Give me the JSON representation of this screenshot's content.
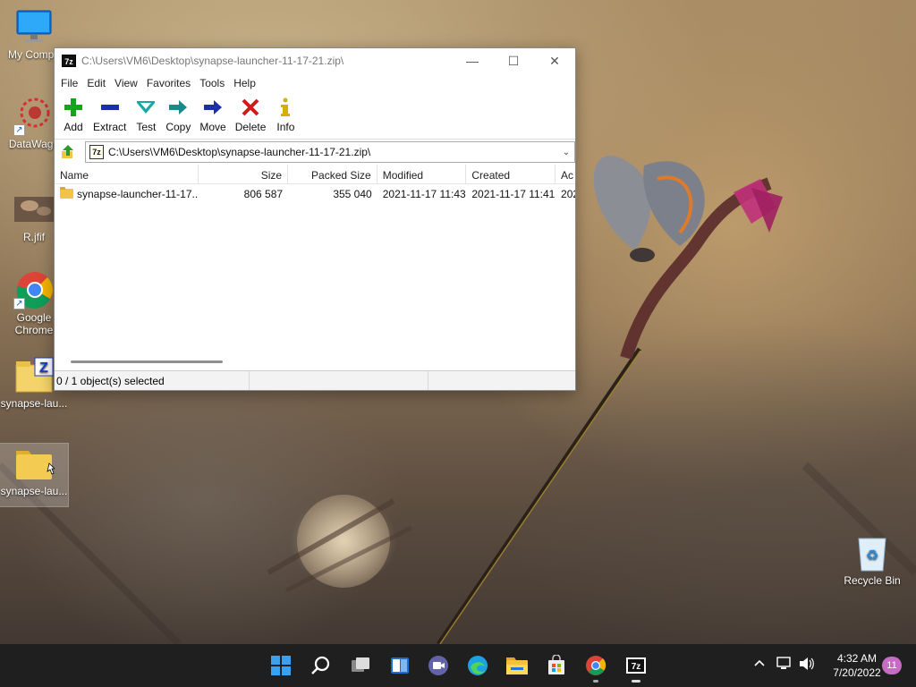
{
  "desktop": {
    "icons": [
      {
        "label": "My Compu"
      },
      {
        "label": "DataWago"
      },
      {
        "label": "R.jfif"
      },
      {
        "label": "Google Chrome"
      },
      {
        "label": "synapse-lau..."
      },
      {
        "label": "synapse-lau..."
      },
      {
        "label": "Recycle Bin"
      }
    ]
  },
  "window": {
    "title": "C:\\Users\\VM6\\Desktop\\synapse-launcher-11-17-21.zip\\",
    "app_icon_text": "7z",
    "controls": {
      "minimize": "—",
      "maximize": "☐",
      "close": "✕"
    },
    "menu": [
      "File",
      "Edit",
      "View",
      "Favorites",
      "Tools",
      "Help"
    ],
    "toolbar": [
      {
        "label": "Add",
        "icon": "add-icon",
        "color": "#1aa31a"
      },
      {
        "label": "Extract",
        "icon": "extract-icon",
        "color": "#1a2fa8"
      },
      {
        "label": "Test",
        "icon": "test-icon",
        "color": "#18a8a8"
      },
      {
        "label": "Copy",
        "icon": "copy-icon",
        "color": "#1a8a8a"
      },
      {
        "label": "Move",
        "icon": "move-icon",
        "color": "#1a2fa8"
      },
      {
        "label": "Delete",
        "icon": "delete-icon",
        "color": "#d11a1a"
      },
      {
        "label": "Info",
        "icon": "info-icon",
        "color": "#d4b000"
      }
    ],
    "address": "C:\\Users\\VM6\\Desktop\\synapse-launcher-11-17-21.zip\\",
    "columns": [
      "Name",
      "Size",
      "Packed Size",
      "Modified",
      "Created",
      "Ac"
    ],
    "rows": [
      {
        "name": "synapse-launcher-11-17...",
        "size": "806 587",
        "packed": "355 040",
        "modified": "2021-11-17 11:43",
        "created": "2021-11-17 11:41",
        "accessed": "202"
      }
    ],
    "status": "0 / 1 object(s) selected"
  },
  "taskbar": {
    "time": "4:32 AM",
    "date": "7/20/2022",
    "notifications": "11"
  }
}
